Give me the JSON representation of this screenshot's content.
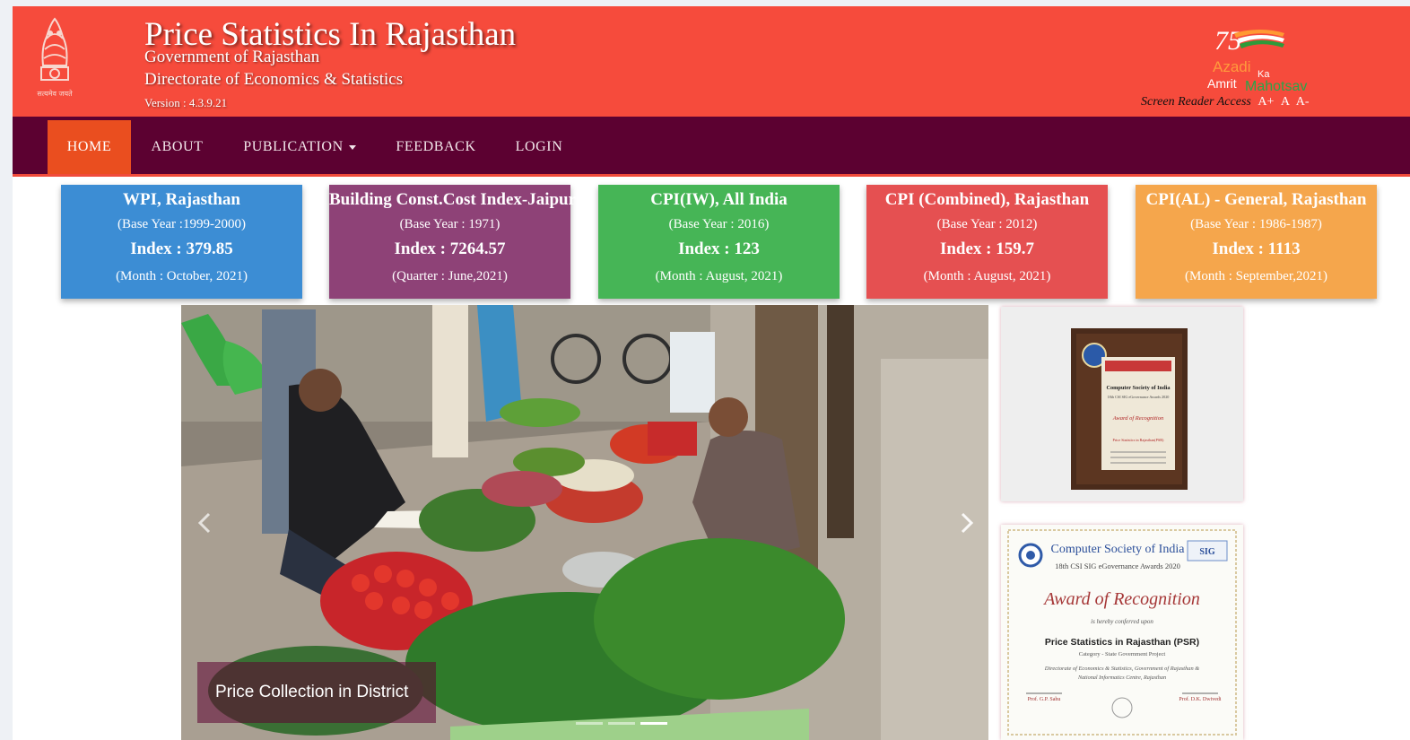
{
  "header": {
    "title": "Price Statistics In Rajasthan",
    "subtitle1": "Government of Rajasthan",
    "subtitle2": "Directorate of Economics & Statistics",
    "version": "Version : 4.3.9.21",
    "emblem_motto": "सत्यमेव जयते",
    "azadi_logo": {
      "number": "75",
      "line1": "Azadi",
      "ka": "Ka",
      "line2a": "Amrit",
      "line2b": "Mahotsav"
    },
    "screen_reader_label": "Screen Reader Access",
    "font_controls": [
      "A+",
      "A",
      "A-"
    ]
  },
  "nav": {
    "items": [
      "HOME",
      "ABOUT",
      "PUBLICATION",
      "FEEDBACK",
      "LOGIN"
    ],
    "active": "HOME"
  },
  "cards": [
    {
      "title": "WPI, Rajasthan",
      "base": "(Base Year :1999-2000)",
      "index": "Index : 379.85",
      "period": "(Month : October, 2021)",
      "color": "#3c8dd4"
    },
    {
      "title": "Building Const.Cost Index-Jaipur",
      "base": "(Base Year : 1971)",
      "index": "Index : 7264.57",
      "period": "(Quarter : June,2021)",
      "color": "#8e4277"
    },
    {
      "title": "CPI(IW), All India",
      "base": "(Base Year : 2016)",
      "index": "Index : 123",
      "period": "(Month : August, 2021)",
      "color": "#46b556"
    },
    {
      "title": "CPI (Combined), Rajasthan",
      "base": "(Base Year : 2012)",
      "index": "Index : 159.7",
      "period": "(Month : August, 2021)",
      "color": "#e55051"
    },
    {
      "title": "CPI(AL) - General, Rajasthan",
      "base": "(Base Year : 1986-1987)",
      "index": "Index : 1113",
      "period": "(Month : September,2021)",
      "color": "#f5a64c"
    }
  ],
  "carousel": {
    "caption": "Price Collection in District",
    "slides": 3,
    "active_slide": 3
  },
  "awards": {
    "plaque": {
      "line1": "Computer Society of India",
      "line2": "18th CSI SIG eGovernance Awards 2020",
      "line3": "Award of Recognition",
      "line4": "Price Statistics in Rajasthan(PSR)"
    },
    "certificate": {
      "org": "Computer Society of India",
      "event": "18th CSI SIG eGovernance Awards 2020",
      "award": "Award of Recognition",
      "conferred": "is hereby conferred upon",
      "project": "Price Statistics in Rajasthan (PSR)",
      "category": "Category - State Government Project",
      "dept1": "Directorate of Economics & Statistics, Government of Rajasthan &",
      "dept2": "National Informatics Centre, Rajasthan",
      "sign_left": "Prof. G.P. Sahu",
      "sign_right": "Prof. D.K. Dwivedi"
    }
  }
}
